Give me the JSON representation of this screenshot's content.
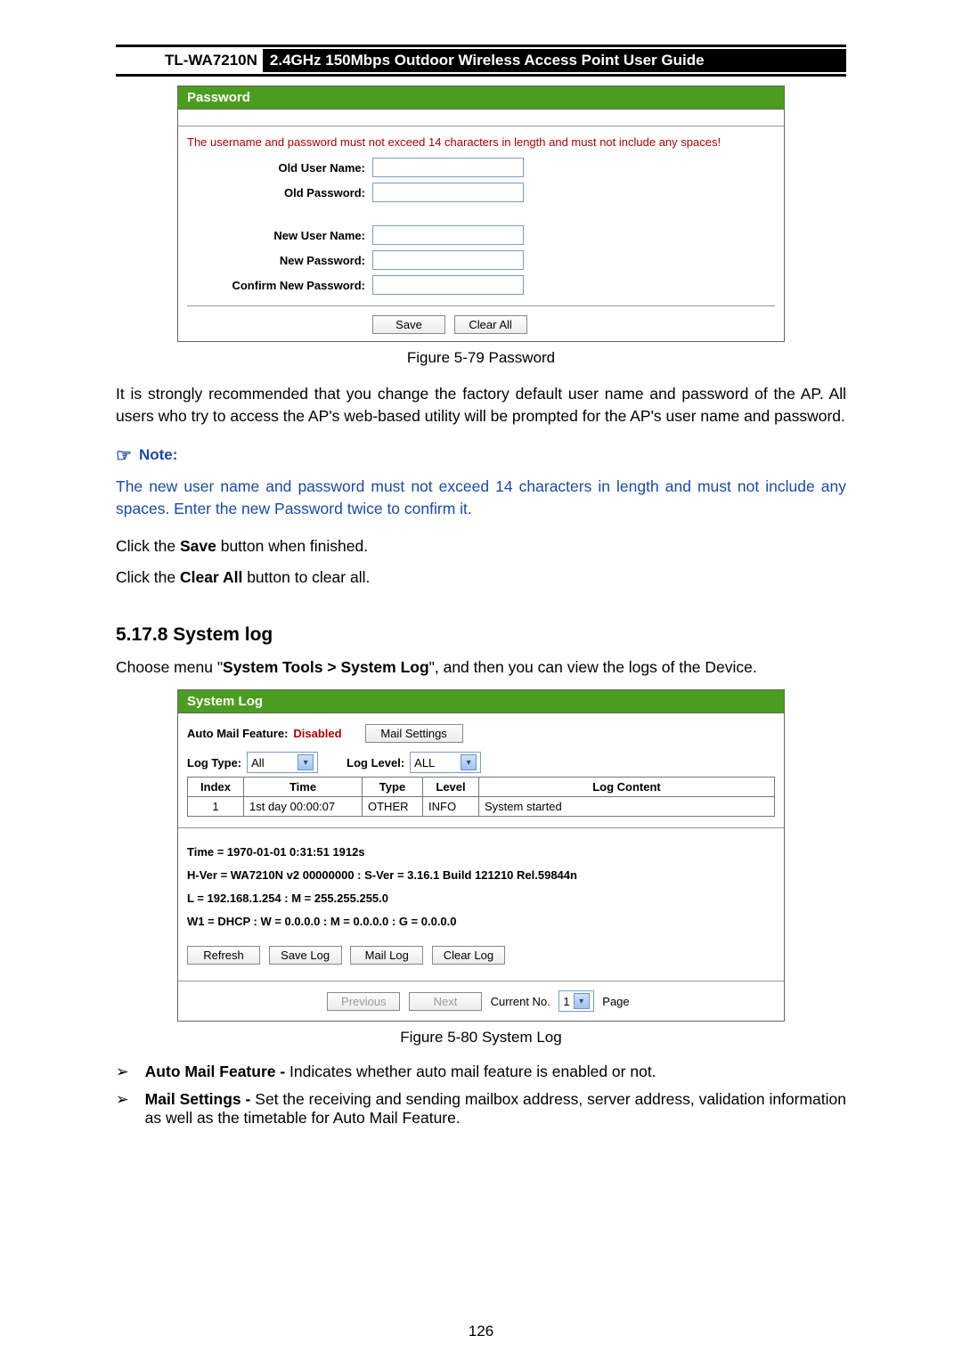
{
  "header": {
    "model": "TL-WA7210N",
    "title": "2.4GHz 150Mbps Outdoor Wireless Access Point User Guide"
  },
  "password_panel": {
    "title": "Password",
    "warn": "The username and password must not exceed 14 characters in length and must not include any spaces!",
    "old_user_label": "Old User Name:",
    "old_pass_label": "Old Password:",
    "new_user_label": "New User Name:",
    "new_pass_label": "New Password:",
    "confirm_pass_label": "Confirm New Password:",
    "save_btn": "Save",
    "clear_btn": "Clear All"
  },
  "fig1_caption": "Figure 5-79 Password",
  "para1": "It is strongly recommended that you change the factory default user name and password of the AP. All users who try to access the AP's web-based utility will be prompted for the AP's user name and password.",
  "note_label": "Note:",
  "note_body": "The new user name and password must not exceed 14 characters in length and must not include any spaces. Enter the new Password twice to confirm it.",
  "click_save_pre": "Click the ",
  "click_save_bold": "Save",
  "click_save_post": " button when finished.",
  "click_clear_pre": "Click the ",
  "click_clear_bold": "Clear All",
  "click_clear_post": " button to clear all.",
  "section_heading": "5.17.8 System log",
  "section_intro_pre": "Choose menu \"",
  "section_intro_bold": "System Tools > System Log",
  "section_intro_post": "\", and then you can view the logs of the Device.",
  "log_panel": {
    "title": "System Log",
    "auto_mail_label": "Auto Mail Feature:",
    "auto_mail_value": "Disabled",
    "mail_settings_btn": "Mail Settings",
    "log_type_label": "Log Type:",
    "log_type_value": "All",
    "log_level_label": "Log Level:",
    "log_level_value": "ALL",
    "cols": {
      "index": "Index",
      "time": "Time",
      "type": "Type",
      "level": "Level",
      "content": "Log Content"
    },
    "rows": [
      {
        "index": "1",
        "time": "1st day 00:00:07",
        "type": "OTHER",
        "level": "INFO",
        "content": "System started"
      }
    ],
    "meta": {
      "time_line": "Time = 1970-01-01 0:31:51 1912s",
      "hver_line": "H-Ver = WA7210N v2 00000000 : S-Ver = 3.16.1 Build 121210 Rel.59844n",
      "l_line": "L = 192.168.1.254 : M = 255.255.255.0",
      "w1_line": "W1 = DHCP : W = 0.0.0.0 : M = 0.0.0.0 : G = 0.0.0.0"
    },
    "buttons": {
      "refresh": "Refresh",
      "save_log": "Save Log",
      "mail_log": "Mail Log",
      "clear_log": "Clear Log"
    },
    "pager": {
      "prev": "Previous",
      "next": "Next",
      "current_label": "Current No.",
      "current_value": "1",
      "page_label": "Page"
    }
  },
  "fig2_caption": "Figure 5-80    System Log",
  "bullets": {
    "b1_bold": "Auto Mail Feature - ",
    "b1_rest": "Indicates whether auto mail feature is enabled or not.",
    "b2_bold": "Mail Settings - ",
    "b2_rest": "Set the receiving and sending mailbox address, server address, validation information as well as the timetable for Auto Mail Feature."
  },
  "page_number": "126"
}
